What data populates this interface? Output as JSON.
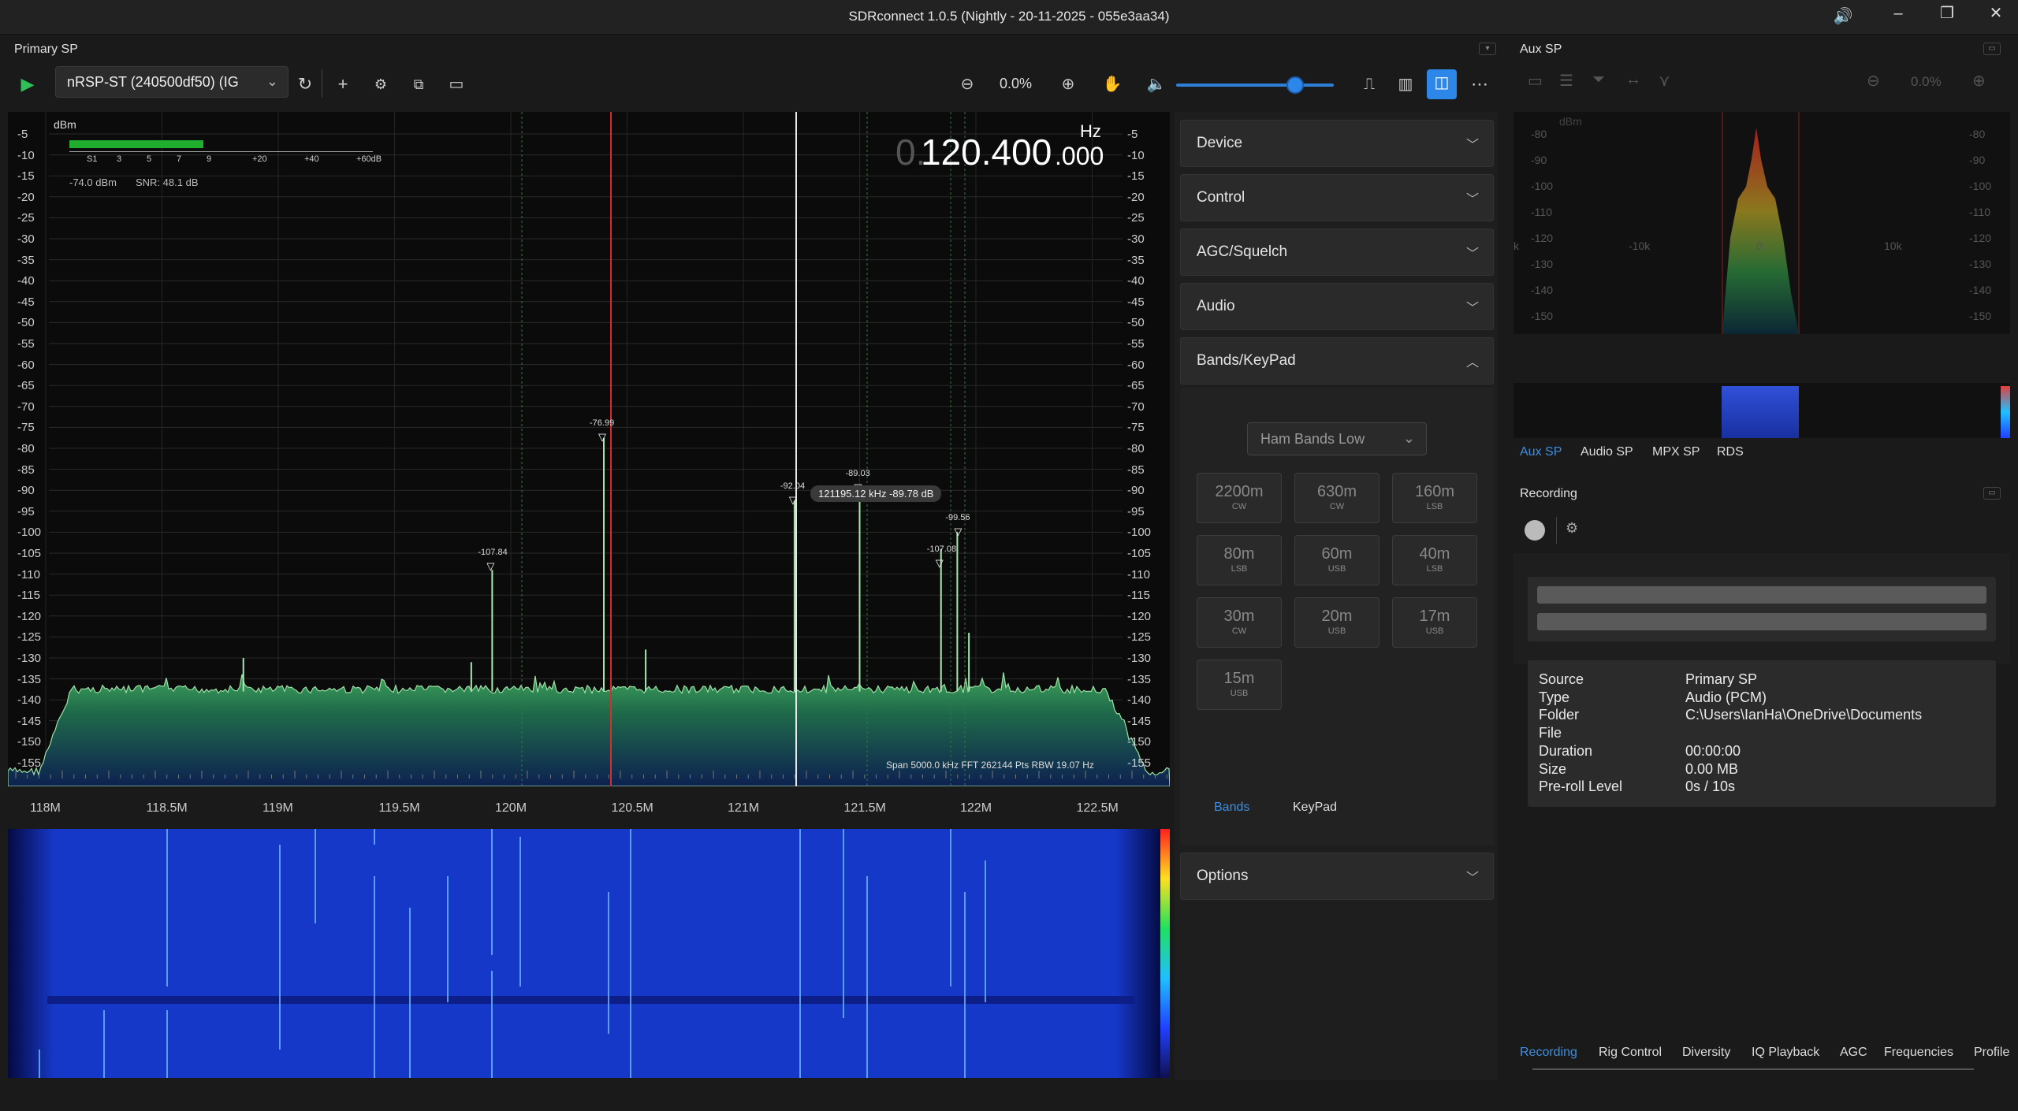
{
  "window": {
    "title": "SDRconnect 1.0.5 (Nightly - 20-11-2025 - 055e3aa34)",
    "min": "–",
    "max": "❐",
    "close": "✕",
    "volume_icon": "speaker-icon"
  },
  "primary": {
    "header": "Primary SP",
    "device": "nRSP-ST (240500df50) (IG",
    "zoom": "0.0%"
  },
  "spectrum": {
    "unit": "dBm",
    "freq_big": "120.400",
    "freq_small": ".000",
    "freq_prefix": "0.",
    "freq_unit": "Hz",
    "level": "-74.0 dBm",
    "snr": "SNR:  48.1 dB",
    "smeter_ticks": [
      "S1",
      "3",
      "5",
      "7",
      "9",
      "+20",
      "+40",
      "+60dB"
    ],
    "y_ticks": [
      "-5",
      "-10",
      "-15",
      "-20",
      "-25",
      "-30",
      "-35",
      "-40",
      "-45",
      "-50",
      "-55",
      "-60",
      "-65",
      "-70",
      "-75",
      "-80",
      "-85",
      "-90",
      "-95",
      "-100",
      "-105",
      "-110",
      "-115",
      "-120",
      "-125",
      "-130",
      "-135",
      "-140",
      "-145",
      "-150",
      "-155"
    ],
    "x_ticks": [
      "118M",
      "118.5M",
      "119M",
      "119.5M",
      "120M",
      "120.5M",
      "121M",
      "121.5M",
      "122M",
      "122.5M"
    ],
    "markers": [
      {
        "label": "-107.84"
      },
      {
        "label": "-76.99"
      },
      {
        "label": "-92.04"
      },
      {
        "label": "-89.03"
      },
      {
        "label": "-107.08"
      },
      {
        "label": "-99.56"
      }
    ],
    "cursor_readout": "121195.12 kHz  -89.78 dB",
    "footer": "Span 5000.0 kHz  FFT 262144 Pts   RBW 19.07 Hz"
  },
  "sidebar": {
    "sections": [
      {
        "label": "Device",
        "state": "collapsed"
      },
      {
        "label": "Control",
        "state": "collapsed"
      },
      {
        "label": "AGC/Squelch",
        "state": "collapsed"
      },
      {
        "label": "Audio",
        "state": "collapsed"
      },
      {
        "label": "Bands/KeyPad",
        "state": "expanded"
      },
      {
        "label": "Options",
        "state": "collapsed"
      }
    ],
    "ham_select": "Ham Bands Low",
    "bands": [
      {
        "name": "2200m",
        "mode": "CW"
      },
      {
        "name": "630m",
        "mode": "CW"
      },
      {
        "name": "160m",
        "mode": "LSB"
      },
      {
        "name": "80m",
        "mode": "LSB"
      },
      {
        "name": "60m",
        "mode": "USB"
      },
      {
        "name": "40m",
        "mode": "LSB"
      },
      {
        "name": "30m",
        "mode": "CW"
      },
      {
        "name": "20m",
        "mode": "USB"
      },
      {
        "name": "17m",
        "mode": "USB"
      },
      {
        "name": "15m",
        "mode": "USB"
      }
    ],
    "tab_bands": "Bands",
    "tab_keypad": "KeyPad"
  },
  "aux": {
    "header": "Aux SP",
    "zoom": "0.0%",
    "unit": "dBm",
    "y_ticks": [
      "-80",
      "-90",
      "-100",
      "-110",
      "-120",
      "-130",
      "-140",
      "-150"
    ],
    "x_ticks": [
      "k",
      "-10k",
      "0",
      "10k"
    ],
    "tabs": [
      "Aux SP",
      "Audio SP",
      "MPX SP",
      "RDS"
    ]
  },
  "recording": {
    "header": "Recording",
    "rows": [
      {
        "k": "Source",
        "v": "Primary SP"
      },
      {
        "k": "Type",
        "v": "Audio (PCM)"
      },
      {
        "k": "Folder",
        "v": "C:\\Users\\IanHa\\OneDrive\\Documents"
      },
      {
        "k": "File",
        "v": ""
      },
      {
        "k": "Duration",
        "v": "00:00:00"
      },
      {
        "k": "Size",
        "v": "0.00 MB"
      },
      {
        "k": "Pre-roll Level",
        "v": "0s / 10s"
      }
    ]
  },
  "bottom_tabs": [
    "Recording",
    "Rig Control",
    "Diversity",
    "IQ Playback",
    "AGC",
    "Frequencies",
    "Profile"
  ],
  "colors": {
    "accent": "#2d87e8",
    "spectrum_fill": "#3fa35a",
    "vfo_line": "#d03030",
    "waterfall": "#1a3fd8"
  }
}
